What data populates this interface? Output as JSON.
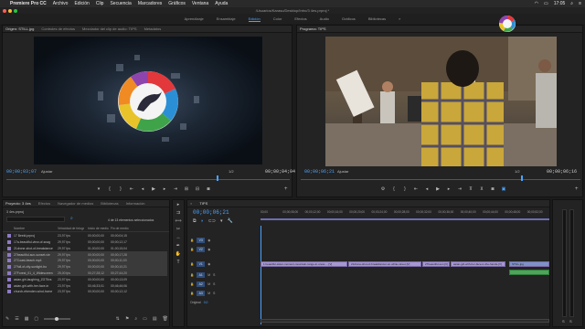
{
  "menubar": {
    "apple": "",
    "app": "Premiere Pro CC",
    "items": [
      "Archivo",
      "Edición",
      "Clip",
      "Secuencia",
      "Marcadores",
      "Gráficos",
      "Ventana",
      "Ayuda"
    ],
    "clock": "17:05"
  },
  "titlebar": {
    "title": "/Usuarios/Karasu/Desktop/Intro/3 4es.prproj *"
  },
  "workspaces": [
    "Aprendizaje",
    "Ensamblaje",
    "Edición",
    "Color",
    "Efectos",
    "Audio",
    "Gráficos",
    "Bibliotecas"
  ],
  "active_workspace": "Edición",
  "source": {
    "tabs": [
      "Origen: STILL.jpg",
      "Controles de efectos",
      "Mezclador del clip de audio: TIPS",
      "Metadatos"
    ],
    "timecode_in": "00;00;03;07",
    "fit": "Ajustar",
    "scale": "1/2",
    "timecode_dur": "00;00;04;04"
  },
  "program": {
    "tabs": [
      "Programa: TIPS"
    ],
    "timecode_in": "00;00;06;21",
    "fit": "Ajustar",
    "scale": "1/2",
    "timecode_dur": "00;00;06;16"
  },
  "project": {
    "tabs": [
      "Proyecto: 3 4es",
      "Efectos",
      "Navegador de medios",
      "Bibliotecas",
      "Información"
    ],
    "file": "3 4es.prproj",
    "selection": "4 de 13 elementos seleccionados",
    "columns": [
      "Nombre",
      "Velocidad de fotogr",
      "Inicio de medio",
      "Fin de medio"
    ],
    "rows": [
      {
        "name": "17 Beeld.prproj",
        "fps": "23,97 fps",
        "start": "00;00;00;00",
        "end": "00;00;04;15"
      },
      {
        "name": "17a-beautiful-view-of-snag",
        "fps": "29,97 fps",
        "start": "00;00;00;00",
        "end": "00;00;12;17"
      },
      {
        "name": "21drone-shot-of-breakdance",
        "fps": "29,97 fps",
        "start": "01;00;00;00",
        "end": "01;00;15;04"
      },
      {
        "name": "27beautiful-sun-sunset-vie",
        "fps": "29,97 fps",
        "start": "00;00;00;00",
        "end": "00;00;17;28"
      },
      {
        "name": "27Coast-beach.mp4",
        "fps": "29,97 fps",
        "start": "00;00;00;00",
        "end": "00;00;11;03"
      },
      {
        "name": "27full-of-city-sunlight-bo",
        "fps": "29,97 fps",
        "start": "00;00;00;00",
        "end": "00;00;10;21"
      },
      {
        "name": "27Forest_01_4_Widescreen",
        "fps": "25,00 fps",
        "start": "00;27;28;12",
        "end": "00;27;44;20"
      },
      {
        "name": "asian-girl-laughing_ZG75vs",
        "fps": "23,97 fps",
        "start": "00;00;00;00",
        "end": "00;00;13;09"
      },
      {
        "name": "asian-girl-with-her-face-in",
        "fps": "23,97 fps",
        "start": "00;46;33;01",
        "end": "00;46;46;06"
      },
      {
        "name": "church-ebenden-wind-home",
        "fps": "23,97 fps",
        "start": "00;00;00;00",
        "end": "00;00;12;12"
      }
    ]
  },
  "timeline": {
    "tab": "TIPS",
    "timecode": "00;00;06;21",
    "ruler": [
      "00;00",
      "00;00;08;00",
      "00;00;12;00",
      "00;00;16;00",
      "00;00;20;00",
      "00;00;24;00",
      "00;00;28;00",
      "00;00;32;00",
      "00;00;36;00",
      "00;00;40;00",
      "00;00;44;00",
      "00;00;48;00",
      "00;00;52;00"
    ],
    "video_tracks": [
      "V3",
      "V2",
      "V1"
    ],
    "audio_tracks": [
      "A1",
      "A2",
      "A3"
    ],
    "master": {
      "label": "Original",
      "value": "0,0"
    },
    "clips": [
      "1 beautiful-sister-moment-mountain-range-in-snow-... [V]",
      "21drone-shot-of-breakdancer-on-white-street-[V]",
      "27beautiful-sun [V]",
      "asian-girl-with-her-face-in-the-hands-[V]",
      "STILL.jpg"
    ]
  },
  "colors": {
    "accent": "#4aa3ff",
    "clip": "#a697d1",
    "audio_clip": "#4fa35a"
  }
}
